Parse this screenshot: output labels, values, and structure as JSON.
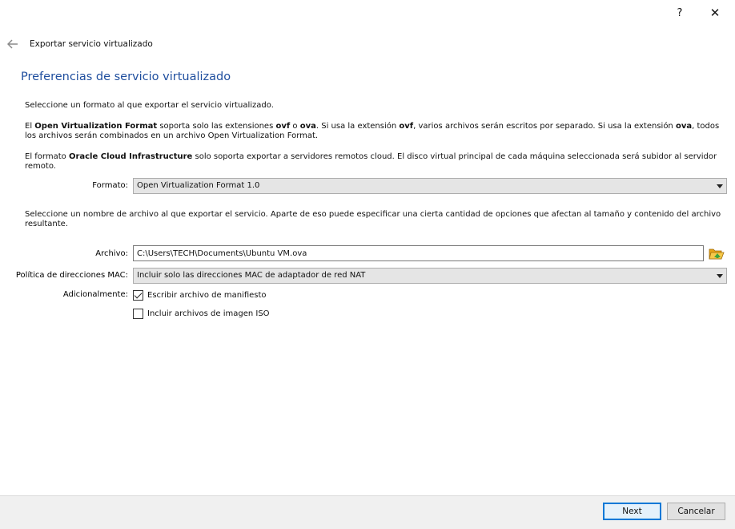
{
  "titlebar": {
    "help": "?",
    "close": "✕"
  },
  "nav": {
    "title": "Exportar servicio virtualizado"
  },
  "page": {
    "heading": "Preferencias de servicio virtualizado"
  },
  "intro": {
    "format_prompt": "Seleccione un formato al que exportar el servicio virtualizado.",
    "ovf_p1": "El ",
    "ovf_bold": "Open Virtualization Format",
    "ovf_p2": " soporta solo las extensiones ",
    "ovf_ext1": "ovf",
    "ovf_p3": " o ",
    "ovf_ext2": "ova",
    "ovf_p4": ". Si usa la extensión ",
    "ovf_ext3": "ovf",
    "ovf_p5": ", varios archivos serán escritos por separado. Si usa la extensión ",
    "ovf_ext4": "ova",
    "ovf_p6": ", todos los archivos serán combinados en un archivo Open Virtualization Format.",
    "oci_p1": "El formato ",
    "oci_bold": "Oracle Cloud Infrastructure",
    "oci_p2": " solo soporta exportar a servidores remotos cloud. El disco virtual principal de cada máquina seleccionada será subidor al servidor remoto.",
    "file_prompt": "Seleccione un nombre de archivo al que exportar el servicio. Aparte de eso puede especificar una cierta cantidad de opciones que afectan al tamaño y contenido del archivo resultante."
  },
  "form": {
    "format_label": "Formato:",
    "format_value": "Open Virtualization Format 1.0",
    "file_label": "Archivo:",
    "file_value": "C:\\Users\\TECH\\Documents\\Ubuntu VM.ova",
    "mac_label": "Política de direcciones MAC:",
    "mac_value": "Incluir solo las direcciones MAC de adaptador de red NAT",
    "additional_label": "Adicionalmente:",
    "manifest_label": "Escribir archivo de manifiesto",
    "manifest_checked": true,
    "iso_label": "Incluir archivos de imagen ISO",
    "iso_checked": false
  },
  "footer": {
    "next": "Next",
    "cancel": "Cancelar"
  },
  "icons": {
    "back": "arrow-left-icon",
    "folder": "folder-open-icon"
  },
  "colors": {
    "heading": "#1f4e9e",
    "accent": "#0078d7"
  }
}
